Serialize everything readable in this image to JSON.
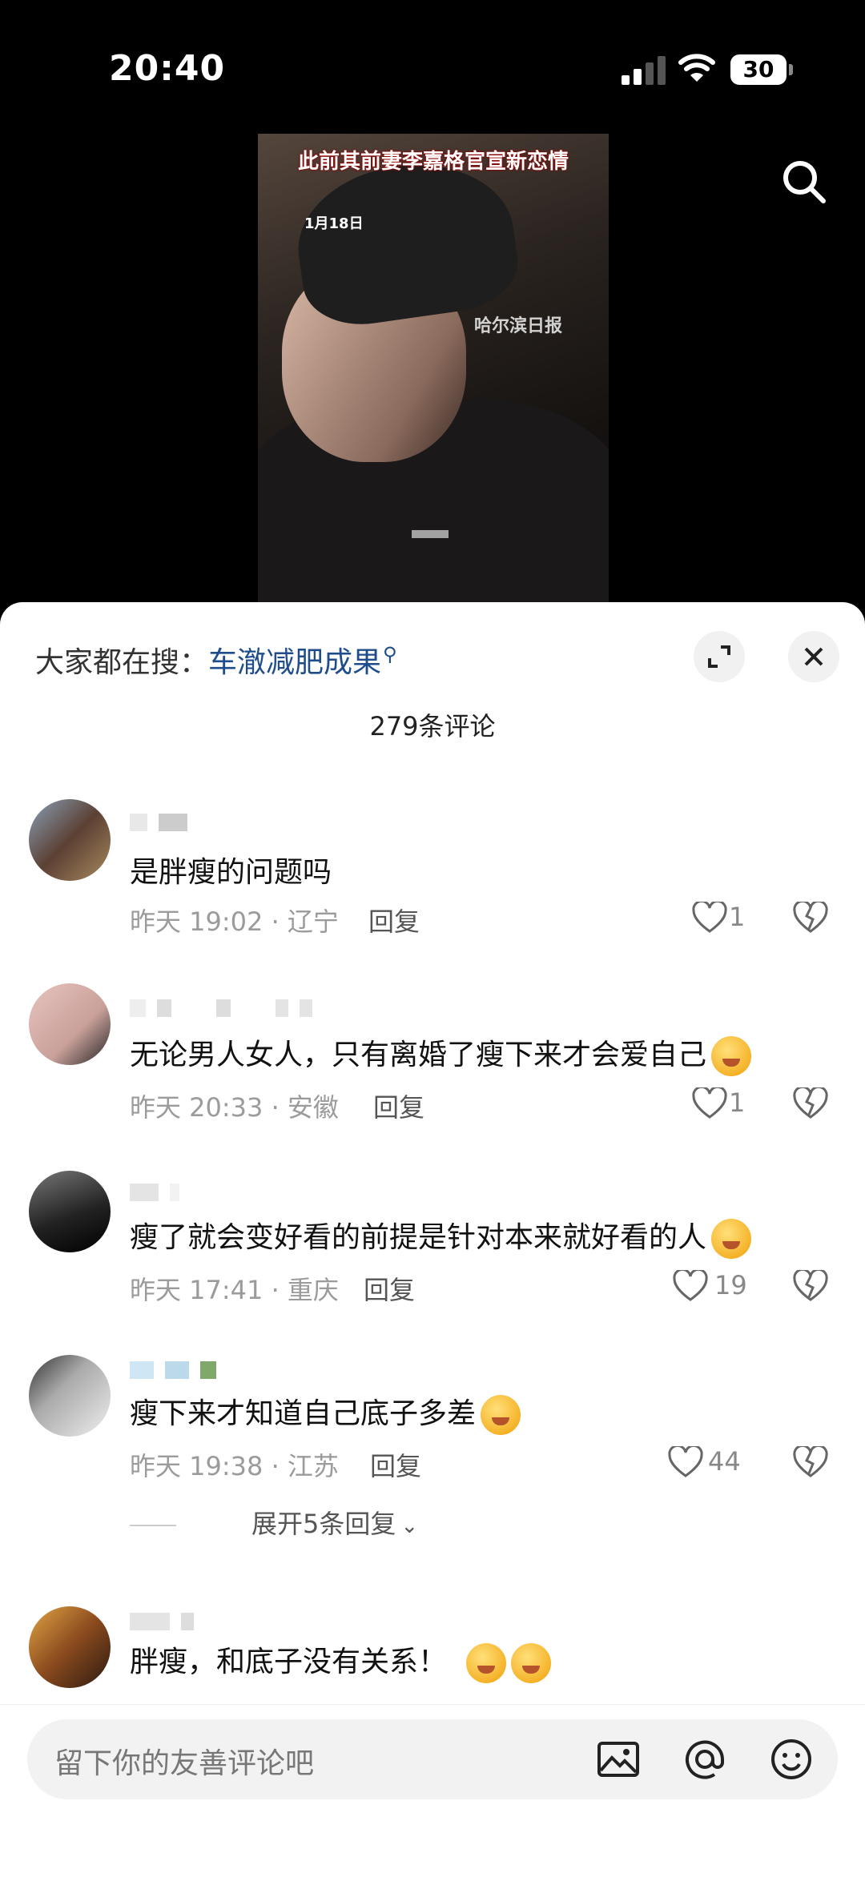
{
  "status_bar": {
    "time": "20:40",
    "battery": "30"
  },
  "video": {
    "caption_top": "",
    "caption": "此前其前妻李嘉格官宣新恋情",
    "date_tag": "1月18日",
    "watermark": "哈尔滨日报"
  },
  "comments_sheet": {
    "hot_search_label": "大家都在搜：",
    "hot_search_keyword": "车澈减肥成果",
    "comment_count": "279条评论",
    "comments": [
      {
        "text": "是胖瘦的问题吗",
        "meta": "昨天 19:02 · 辽宁",
        "reply": "回复",
        "likes": "1"
      },
      {
        "text": "无论男人女人，只有离婚了瘦下来才会爱自己",
        "meta": "昨天 20:33 · 安徽",
        "reply": "回复",
        "likes": "1"
      },
      {
        "text": "瘦了就会变好看的前提是针对本来就好看的人",
        "meta": "昨天 17:41 · 重庆",
        "reply": "回复",
        "likes": "19"
      },
      {
        "text": "瘦下来才知道自己底子多差",
        "meta": "昨天 19:38 · 江苏",
        "reply": "回复",
        "likes": "44",
        "expand": "展开5条回复"
      },
      {
        "text": "胖瘦，和底子没有关系！"
      }
    ]
  },
  "input": {
    "placeholder": "留下你的友善评论吧"
  },
  "icons": [
    "search-icon",
    "expand-icon",
    "close-icon",
    "heart-icon",
    "broken-heart-icon",
    "image-icon",
    "at-icon",
    "emoji-icon",
    "chevron-down-icon"
  ],
  "colors": {
    "link": "#1f4d8c",
    "meta": "#9b9b9b",
    "sheet_bg": "#ffffff"
  }
}
